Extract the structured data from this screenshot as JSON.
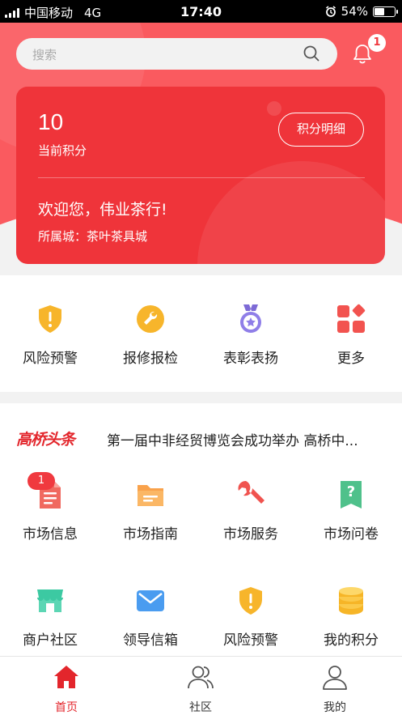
{
  "status_bar": {
    "carrier": "中国移动",
    "network": "4G",
    "time": "17:40",
    "battery": "54%",
    "battery_level": 0.54
  },
  "search": {
    "placeholder": "搜索"
  },
  "notifications": {
    "count": "1"
  },
  "points_card": {
    "points": "10",
    "points_label": "当前积分",
    "detail_button": "积分明细",
    "welcome": "欢迎您，伟业茶行!",
    "city": "所属城：茶叶茶具城"
  },
  "quick_actions": [
    {
      "label": "风险预警",
      "icon": "shield-warning-icon"
    },
    {
      "label": "报修报检",
      "icon": "wrench-icon"
    },
    {
      "label": "表彰表扬",
      "icon": "medal-icon"
    },
    {
      "label": "更多",
      "icon": "more-grid-icon"
    }
  ],
  "news": {
    "logo": "高桥头条",
    "headline": "第一届中非经贸博览会成功举办 高桥中..."
  },
  "services": [
    {
      "label": "市场信息",
      "icon": "document-icon",
      "badge": "1"
    },
    {
      "label": "市场指南",
      "icon": "folder-icon"
    },
    {
      "label": "市场服务",
      "icon": "wrench-icon"
    },
    {
      "label": "市场问卷",
      "icon": "questionnaire-icon"
    },
    {
      "label": "商户社区",
      "icon": "store-icon"
    },
    {
      "label": "领导信箱",
      "icon": "mail-icon"
    },
    {
      "label": "风险预警",
      "icon": "shield-warning-icon"
    },
    {
      "label": "我的积分",
      "icon": "coins-icon"
    }
  ],
  "tabs": [
    {
      "label": "首页",
      "icon": "home-icon",
      "active": true
    },
    {
      "label": "社区",
      "icon": "community-icon"
    },
    {
      "label": "我的",
      "icon": "profile-icon"
    }
  ],
  "colors": {
    "brand": "#ef343a",
    "header": "#fa5a5f",
    "active_tab": "#e3262c"
  }
}
